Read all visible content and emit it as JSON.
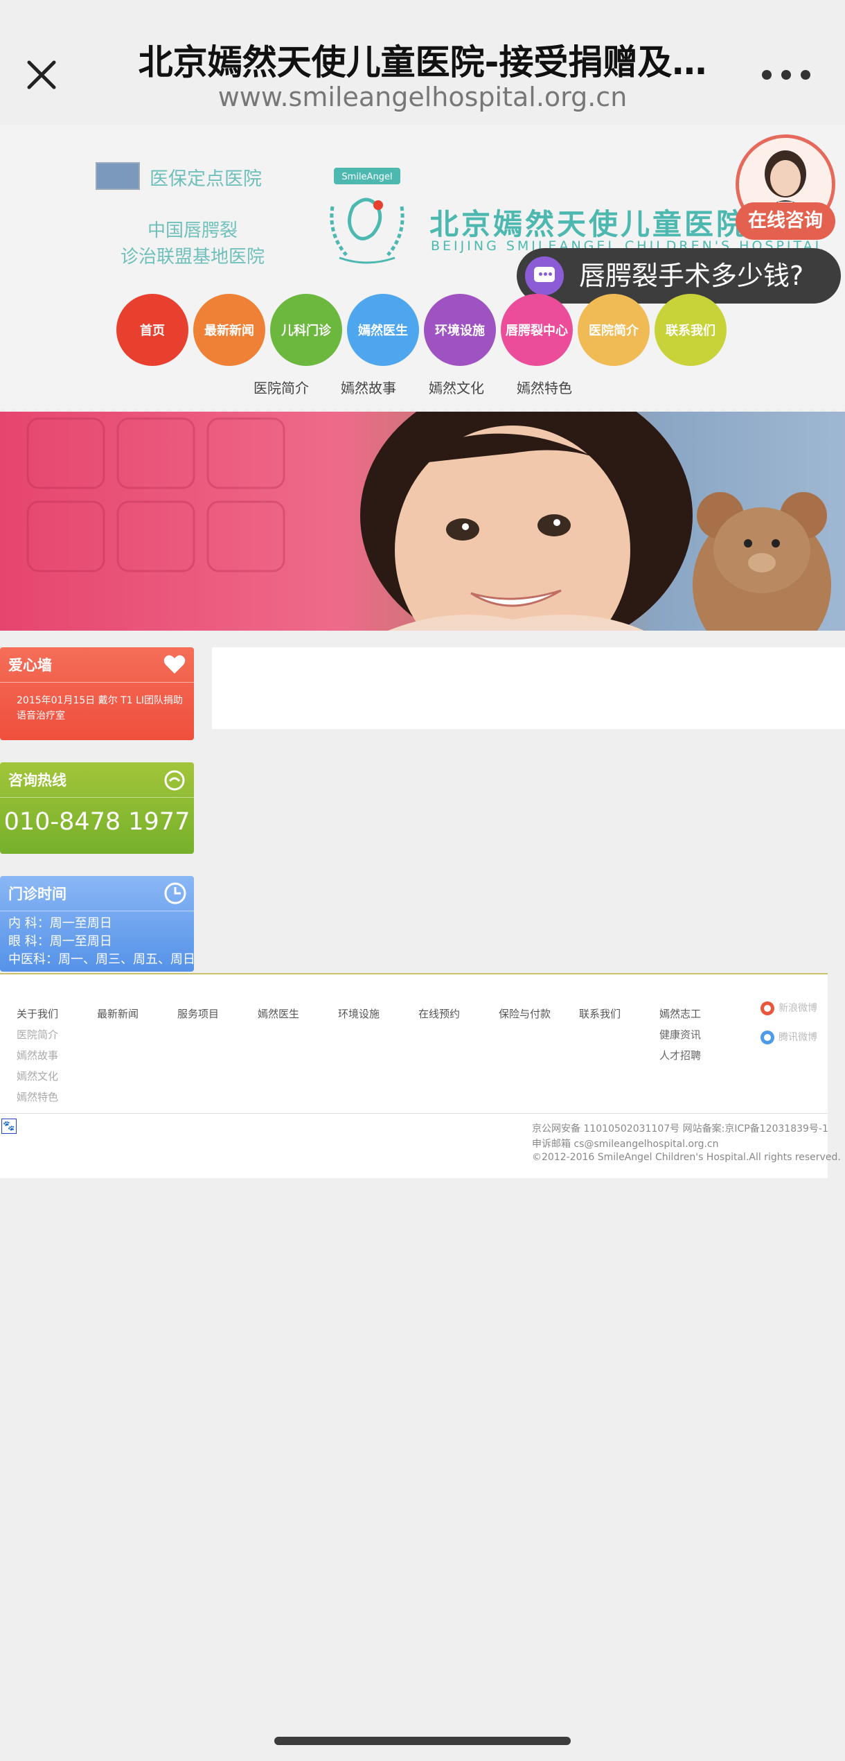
{
  "browser": {
    "title": "北京嫣然天使儿童医院-接受捐赠及…",
    "url": "www.smileangelhospital.org.cn"
  },
  "header": {
    "yibao": "医保定点医院",
    "lianmeng_line1": "中国唇腭裂",
    "lianmeng_line2": "诊治联盟基地医院",
    "logo_cn": "北京嫣然天使儿童医院",
    "logo_en": "BEIJING SMILEANGEL CHILDREN'S HOSPITAL",
    "logo_badge": "SmileAngel",
    "consult_label": "在线咨询",
    "price_question": "唇腭裂手术多少钱?"
  },
  "nav": {
    "items": [
      {
        "label": "首页",
        "color": "#e8402f"
      },
      {
        "label": "最新新闻",
        "color": "#ee8136"
      },
      {
        "label": "儿科门诊",
        "color": "#6cb83e"
      },
      {
        "label": "嫣然医生",
        "color": "#4ea6ee"
      },
      {
        "label": "环境设施",
        "color": "#9f52c2"
      },
      {
        "label": "唇腭裂中心",
        "color": "#ec4d9a"
      },
      {
        "label": "医院简介",
        "color": "#f0bb55"
      },
      {
        "label": "联系我们",
        "color": "#c8d33a"
      }
    ],
    "sub_items": [
      "医院简介",
      "嫣然故事",
      "嫣然文化",
      "嫣然特色"
    ]
  },
  "widgets": {
    "love": {
      "title": "爱心墙",
      "text": "2015年01月15日 戴尔 T1 LI团队捐助语音治疗室"
    },
    "hotline": {
      "title": "咨询热线",
      "number": "010-8478 1977"
    },
    "hours": {
      "title": "门诊时间",
      "lines": [
        "内 科：周一至周日",
        "眼 科：周一至周日",
        "中医科：周一、周三、周五、周日"
      ]
    }
  },
  "footer": {
    "columns": [
      {
        "heading": "关于我们",
        "items": [
          "医院简介",
          "嫣然故事",
          "嫣然文化",
          "嫣然特色"
        ]
      },
      {
        "heading": "最新新闻",
        "items": []
      },
      {
        "heading": "服务项目",
        "items": []
      },
      {
        "heading": "嫣然医生",
        "items": []
      },
      {
        "heading": "环境设施",
        "items": []
      },
      {
        "heading": "在线预约",
        "items": []
      },
      {
        "heading": "保险与付款",
        "items": []
      },
      {
        "heading": "联系我们",
        "items": []
      },
      {
        "heading": "嫣然志工",
        "items": [
          "健康资讯",
          "人才招聘"
        ]
      }
    ],
    "social": [
      {
        "label": "新浪微博",
        "color": "#e8573b"
      },
      {
        "label": "腾讯微博",
        "color": "#4e9be8"
      }
    ],
    "legal": {
      "line1": "京公网安备 11010502031107号 网站备案:京ICP备12031839号-1",
      "line2": "申诉邮箱 cs@smileangelhospital.org.cn",
      "line3": "©2012-2016 SmileAngel Children's Hospital.All rights reserved."
    }
  }
}
